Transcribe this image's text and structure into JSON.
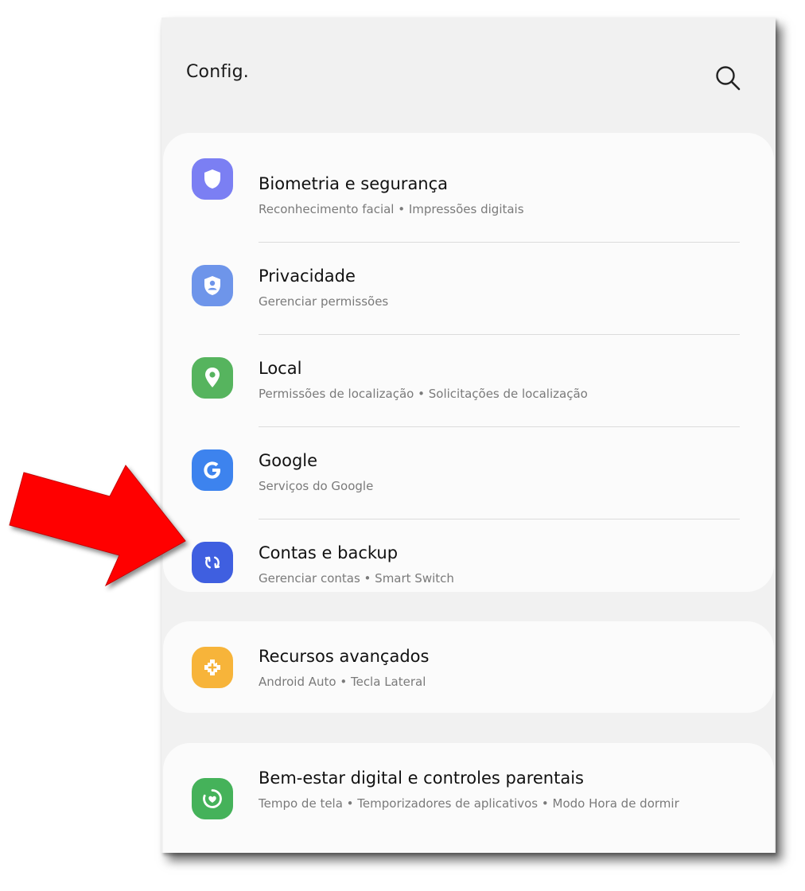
{
  "header": {
    "title": "Config.",
    "search_icon": "search-icon"
  },
  "groups": [
    {
      "items": [
        {
          "title": "Biometria e segurança",
          "subtitle": "Reconhecimento facial • Impressões digitais",
          "icon": "shield-icon",
          "color": "#7b7ff3"
        },
        {
          "title": "Privacidade",
          "subtitle": "Gerenciar permissões",
          "icon": "privacy-shield-icon",
          "color": "#6e95ea"
        },
        {
          "title": "Local",
          "subtitle": "Permissões de localização • Solicitações de localização",
          "icon": "location-pin-icon",
          "color": "#56b45e"
        },
        {
          "title": "Google",
          "subtitle": "Serviços do Google",
          "icon": "google-g-icon",
          "color": "#3d83ee"
        },
        {
          "title": "Contas e backup",
          "subtitle": "Gerenciar contas • Smart Switch",
          "icon": "sync-icon",
          "color": "#3f5fe0"
        }
      ]
    },
    {
      "items": [
        {
          "title": "Recursos avançados",
          "subtitle": "Android Auto • Tecla Lateral",
          "icon": "puzzle-plus-icon",
          "color": "#f7b43a"
        }
      ]
    },
    {
      "items": [
        {
          "title": "Bem-estar digital e controles parentais",
          "subtitle": "Tempo de tela • Temporizadores de aplicativos • Modo Hora de dormir",
          "icon": "wellbeing-icon",
          "color": "#45b25a"
        }
      ]
    }
  ],
  "annotation": {
    "arrow_color": "#ff0000",
    "target": "Contas e backup"
  }
}
